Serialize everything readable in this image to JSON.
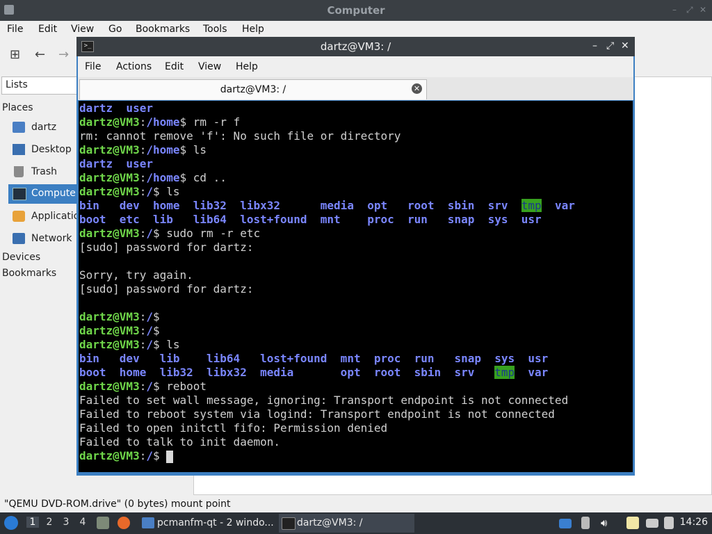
{
  "file_manager": {
    "title": "Computer",
    "menu": [
      "File",
      "Edit",
      "View",
      "Go",
      "Bookmarks",
      "Tools",
      "Help"
    ],
    "lists_label": "Lists",
    "places_heading": "Places",
    "places": [
      {
        "label": "dartz",
        "icon": "home-folder-icon"
      },
      {
        "label": "Desktop",
        "icon": "desktop-icon"
      },
      {
        "label": "Trash",
        "icon": "trash-icon"
      },
      {
        "label": "Computer",
        "icon": "computer-icon",
        "selected": true
      },
      {
        "label": "Applications",
        "icon": "applications-icon"
      },
      {
        "label": "Network",
        "icon": "network-icon"
      }
    ],
    "devices_heading": "Devices",
    "bookmarks_heading": "Bookmarks",
    "status": "\"QEMU DVD-ROM.drive\" (0 bytes) mount point"
  },
  "terminal": {
    "title": "dartz@VM3: /",
    "menu": [
      "File",
      "Actions",
      "Edit",
      "View",
      "Help"
    ],
    "tab_label": "dartz@VM3: /",
    "lines": [
      [
        [
          "d",
          "dartz  user"
        ]
      ],
      [
        [
          "g",
          "dartz@VM3"
        ],
        [
          "w",
          ":"
        ],
        [
          "d",
          "/home"
        ],
        [
          "w",
          "$ rm -r f"
        ]
      ],
      [
        [
          "w",
          "rm: cannot remove 'f': No such file or directory"
        ]
      ],
      [
        [
          "g",
          "dartz@VM3"
        ],
        [
          "w",
          ":"
        ],
        [
          "d",
          "/home"
        ],
        [
          "w",
          "$ ls"
        ]
      ],
      [
        [
          "d",
          "dartz  user"
        ]
      ],
      [
        [
          "g",
          "dartz@VM3"
        ],
        [
          "w",
          ":"
        ],
        [
          "d",
          "/home"
        ],
        [
          "w",
          "$ cd .."
        ]
      ],
      [
        [
          "g",
          "dartz@VM3"
        ],
        [
          "w",
          ":"
        ],
        [
          "d",
          "/"
        ],
        [
          "w",
          "$ ls"
        ]
      ],
      [
        [
          "d",
          "bin   dev  home  lib32  libx32      media  opt   root  sbin  srv  "
        ],
        [
          "h",
          "tmp"
        ],
        [
          "w",
          "  "
        ],
        [
          "d",
          "var"
        ]
      ],
      [
        [
          "d",
          "boot  etc  lib   lib64  lost+found  mnt    proc  run   snap  sys  usr"
        ]
      ],
      [
        [
          "g",
          "dartz@VM3"
        ],
        [
          "w",
          ":"
        ],
        [
          "d",
          "/"
        ],
        [
          "w",
          "$ sudo rm -r etc"
        ]
      ],
      [
        [
          "w",
          "[sudo] password for dartz:"
        ]
      ],
      [
        [
          "w",
          ""
        ]
      ],
      [
        [
          "w",
          "Sorry, try again."
        ]
      ],
      [
        [
          "w",
          "[sudo] password for dartz:"
        ]
      ],
      [
        [
          "w",
          ""
        ]
      ],
      [
        [
          "g",
          "dartz@VM3"
        ],
        [
          "w",
          ":"
        ],
        [
          "d",
          "/"
        ],
        [
          "w",
          "$"
        ]
      ],
      [
        [
          "g",
          "dartz@VM3"
        ],
        [
          "w",
          ":"
        ],
        [
          "d",
          "/"
        ],
        [
          "w",
          "$"
        ]
      ],
      [
        [
          "g",
          "dartz@VM3"
        ],
        [
          "w",
          ":"
        ],
        [
          "d",
          "/"
        ],
        [
          "w",
          "$ ls"
        ]
      ],
      [
        [
          "d",
          "bin   dev   lib    lib64   lost+found  mnt  proc  run   snap  sys  usr"
        ]
      ],
      [
        [
          "d",
          "boot  home  lib32  libx32  media       opt  root  sbin  srv   "
        ],
        [
          "h",
          "tmp"
        ],
        [
          "w",
          "  "
        ],
        [
          "d",
          "var"
        ]
      ],
      [
        [
          "g",
          "dartz@VM3"
        ],
        [
          "w",
          ":"
        ],
        [
          "d",
          "/"
        ],
        [
          "w",
          "$ reboot"
        ]
      ],
      [
        [
          "w",
          "Failed to set wall message, ignoring: Transport endpoint is not connected"
        ]
      ],
      [
        [
          "w",
          "Failed to reboot system via logind: Transport endpoint is not connected"
        ]
      ],
      [
        [
          "w",
          "Failed to open initctl fifo: Permission denied"
        ]
      ],
      [
        [
          "w",
          "Failed to talk to init daemon."
        ]
      ],
      [
        [
          "g",
          "dartz@VM3"
        ],
        [
          "w",
          ":"
        ],
        [
          "d",
          "/"
        ],
        [
          "w",
          "$ "
        ],
        [
          "cursor",
          ""
        ]
      ]
    ]
  },
  "taskbar": {
    "workspaces": [
      "1",
      "2",
      "3",
      "4"
    ],
    "tasks": [
      {
        "label": "pcmanfm-qt - 2 windo...",
        "icon": "folder-icon"
      },
      {
        "label": "dartz@VM3: /",
        "icon": "terminal-icon"
      }
    ],
    "clock": "14:26"
  },
  "colors": {
    "prompt_green": "#6fd64a",
    "dir_blue": "#7a86ff",
    "selection_blue": "#3c7fc2",
    "taskbar_bg": "#2b3036"
  }
}
